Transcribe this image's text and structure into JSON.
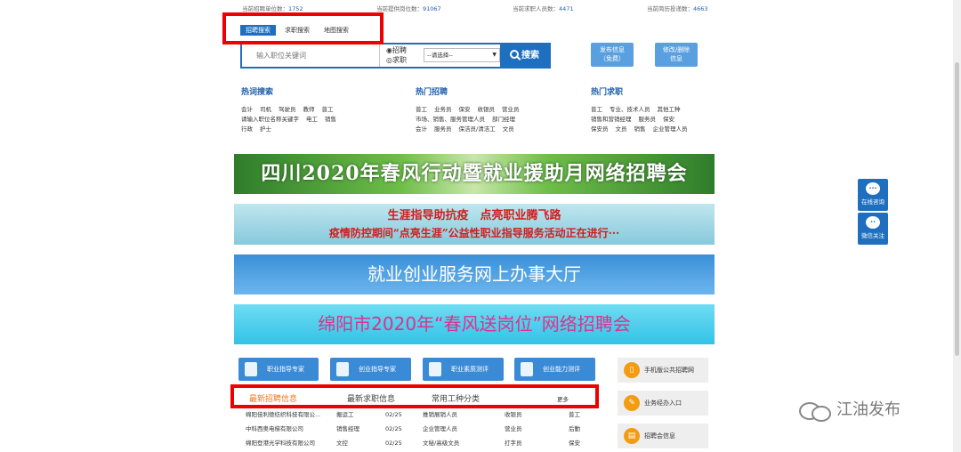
{
  "stats": {
    "employers_label": "当前招聘单位数：",
    "employers_value": "1752",
    "positions_label": "当前提供岗位数：",
    "positions_value": "91067",
    "seekers_label": "当前求职人员数：",
    "seekers_value": "4471",
    "resumes_label": "当前简历投递数：",
    "resumes_value": "4663"
  },
  "search_tabs": [
    "招聘搜索",
    "求职搜索",
    "地图搜索"
  ],
  "search": {
    "placeholder": "输入职位关键词",
    "radio_recruit": "◉招聘",
    "radio_seek": "◎求职",
    "select_value": "--请选择--",
    "button": "搜索"
  },
  "side_buttons": {
    "publish": "发布信息",
    "publish_sub": "（免费）",
    "edit": "修改/删除",
    "edit_sub": "信息"
  },
  "hot": {
    "keywords": {
      "title": "热词搜索",
      "rows": [
        [
          "会计",
          "司机",
          "驾驶员",
          "教师",
          "普工"
        ],
        [
          "请输入职位名称关键字",
          "电工",
          "销售"
        ],
        [
          "行政",
          "护士"
        ]
      ]
    },
    "recruit": {
      "title": "热门招聘",
      "rows": [
        [
          "普工",
          "业务员",
          "保安",
          "收银员",
          "营业员"
        ],
        [
          "市场、销售、服务管理人员",
          "部门经理"
        ],
        [
          "会计",
          "服务员",
          "保洁员/清洁工",
          "文员"
        ]
      ]
    },
    "seek": {
      "title": "热门求职",
      "rows": [
        [
          "普工",
          "专业、技术人员",
          "其他工种"
        ],
        [
          "销售和营销经理",
          "服务员",
          "保安"
        ],
        [
          "保安员",
          "文员",
          "销售",
          "企业管理人员"
        ]
      ]
    }
  },
  "banners": {
    "b1": "四川2020年春风行动暨就业援助月网络招聘会",
    "b2_line1": "生涯指导助抗疫　点亮职业腾飞路",
    "b2_line2": "疫情防控期间“点亮生涯”公益性职业指导服务活动正在进行···",
    "b3": "就业创业服务网上办事大厅",
    "b4": "绵阳市2020年“春风送岗位”网络招聘会"
  },
  "tools": [
    "职业指导专家",
    "创业指导专家",
    "职业素质测评",
    "创业能力测评"
  ],
  "right_tiles": [
    "手机版公共招聘网",
    "业务经办入口",
    "招聘会信息"
  ],
  "list_tabs": {
    "latest_jobs": "最新招聘信息",
    "latest_seekers": "最新求职信息",
    "categories": "常用工种分类",
    "more": "更多"
  },
  "jobs": [
    {
      "company": "绵阳佳利德纺织科技有限公...",
      "position": "搬运工",
      "date": "02/25"
    },
    {
      "company": "中科西奥电梯有限公司",
      "position": "销售经理",
      "date": "02/25"
    },
    {
      "company": "绵阳登港光学科技有限公司",
      "position": "文控",
      "date": "02/25"
    }
  ],
  "categories": [
    [
      "推销展销人员",
      "收银员",
      "普工"
    ],
    [
      "企业管理人员",
      "营业员",
      "后勤"
    ],
    [
      "文秘/高级文员",
      "打字员",
      "保安"
    ]
  ],
  "float": {
    "consult": "在线咨询",
    "wechat": "微信关注"
  },
  "watermark": "江油发布",
  "colors": {
    "accent": "#1e6fbf",
    "highlight_box": "#ee0000",
    "active_tab_text": "#f07820"
  }
}
